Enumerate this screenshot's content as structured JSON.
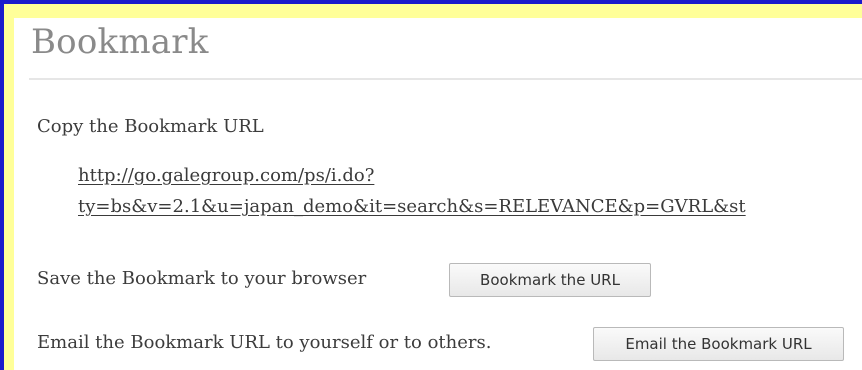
{
  "page": {
    "title": "Bookmark"
  },
  "copy_section": {
    "label": "Copy the Bookmark URL",
    "url_line1": "http://go.galegroup.com/ps/i.do?",
    "url_line2": "ty=bs&v=2.1&u=japan_demo&it=search&s=RELEVANCE&p=GVRL&st"
  },
  "save_section": {
    "label": "Save the Bookmark to your browser",
    "button_label": "Bookmark the URL"
  },
  "email_section": {
    "label": "Email the Bookmark URL to yourself or to others.",
    "button_label": "Email the Bookmark URL"
  },
  "colors": {
    "frame_border": "#1a1acc",
    "frame_fill": "#ffff99",
    "title_text": "#8a8a8a"
  }
}
